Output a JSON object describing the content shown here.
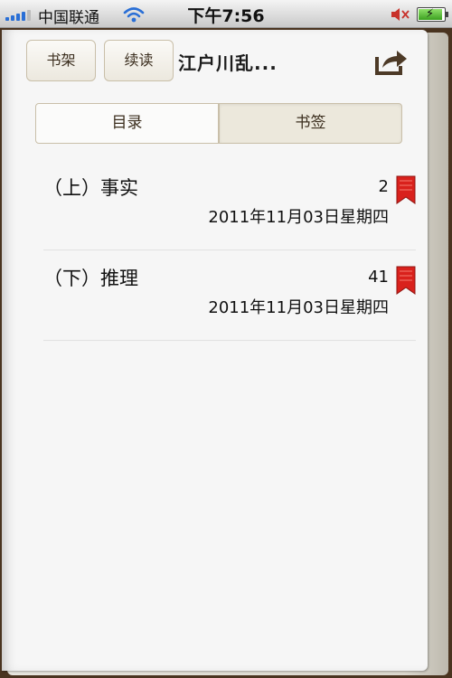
{
  "status_bar": {
    "carrier": "中国联通",
    "time": "下午7:56"
  },
  "toolbar": {
    "bookshelf_label": "书架",
    "continue_label": "续读",
    "book_title": "江户川乱..."
  },
  "tabs": [
    {
      "label": "目录",
      "selected": false
    },
    {
      "label": "书签",
      "selected": true
    }
  ],
  "bookmarks": [
    {
      "title": "（上）事实",
      "page": "2",
      "date": "2011年11月03日星期四"
    },
    {
      "title": "（下）推理",
      "page": "41",
      "date": "2011年11月03日星期四"
    }
  ],
  "colors": {
    "accent_text": "#3b2e1e",
    "bookmark_red": "#d9211c",
    "selected_tab": "#ece8dc"
  },
  "icons": [
    "signal-icon",
    "wifi-icon",
    "mute-icon",
    "battery-icon",
    "share-icon",
    "bookmark-icon"
  ]
}
